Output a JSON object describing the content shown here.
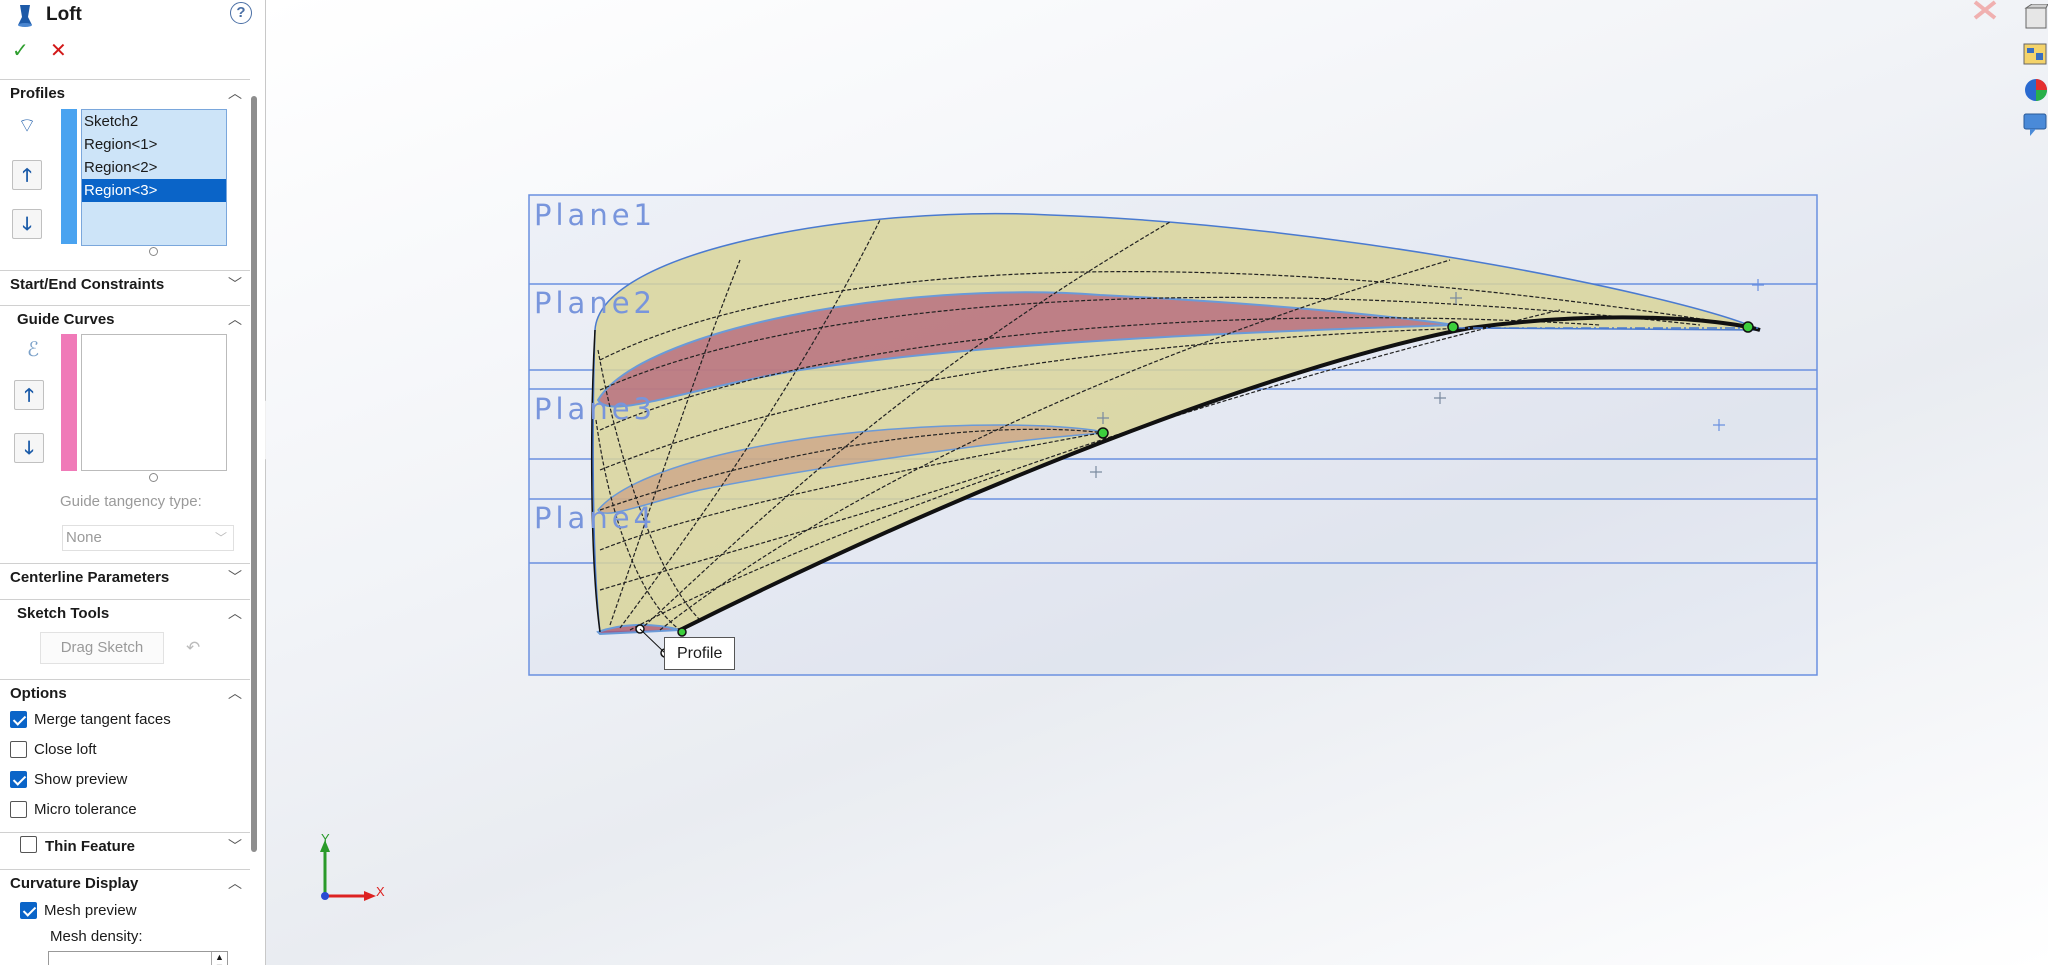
{
  "panel": {
    "title": "Loft",
    "help": "?",
    "ok_symbol": "✓",
    "cancel_symbol": "✕",
    "profiles": {
      "header": "Profiles",
      "items": [
        "Sketch2",
        "Region<1>",
        "Region<2>",
        "Region<3>"
      ],
      "selected_index": 3
    },
    "start_end": {
      "header": "Start/End Constraints"
    },
    "guide_curves": {
      "header": "Guide Curves",
      "tangency_label": "Guide tangency type:",
      "tangency_value": "None"
    },
    "centerline": {
      "header": "Centerline Parameters"
    },
    "sketch_tools": {
      "header": "Sketch Tools",
      "drag_sketch": "Drag Sketch"
    },
    "options": {
      "header": "Options",
      "merge_tangent": "Merge tangent faces",
      "close_loft": "Close loft",
      "show_preview": "Show preview",
      "micro_tolerance": "Micro tolerance"
    },
    "thin_feature": {
      "header": "Thin Feature"
    },
    "curvature": {
      "header": "Curvature Display",
      "mesh_preview": "Mesh preview",
      "mesh_density": "Mesh density:"
    }
  },
  "viewport": {
    "planes": [
      "Plane1",
      "Plane2",
      "Plane3",
      "Plane4"
    ],
    "tooltip": "Profile",
    "axis_x": "X",
    "axis_y": "Y"
  },
  "colors": {
    "accent": "#0a64c8",
    "profile_bar": "#4aa3f0",
    "guide_bar": "#f07ab8",
    "plane_border": "#6a90e0",
    "loft_surface": "#d9d59a",
    "profile_fill": "#b05a78"
  }
}
